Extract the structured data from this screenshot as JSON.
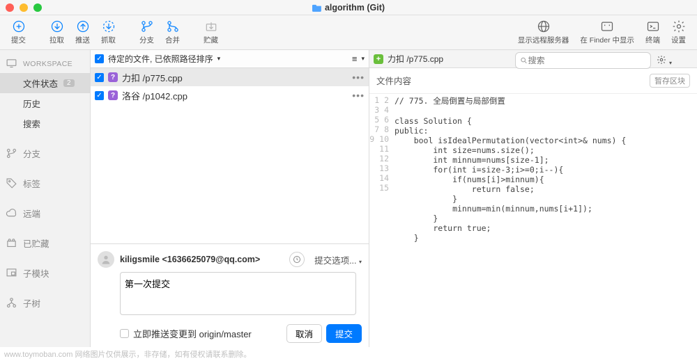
{
  "window": {
    "title": "algorithm (Git)"
  },
  "toolbar": {
    "commit": "提交",
    "pull": "拉取",
    "push": "推送",
    "fetch": "抓取",
    "branch": "分支",
    "merge": "合并",
    "stash": "贮藏",
    "remote_server": "显示远程服务器",
    "finder": "在 Finder 中显示",
    "terminal": "终端",
    "settings": "设置",
    "search_placeholder": "搜索"
  },
  "sidebar": {
    "workspace_header": "WORKSPACE",
    "file_status": "文件状态",
    "file_status_badge": "2",
    "history": "历史",
    "search": "搜索",
    "branches": "分支",
    "tags": "标签",
    "remotes": "远端",
    "stashes": "已贮藏",
    "submodules": "子模块",
    "subtrees": "子树"
  },
  "sorter": "待定的文件, 已依照路径排序",
  "files": [
    {
      "label": "力扣 /p775.cpp",
      "active": true
    },
    {
      "label": "洛谷 /p1042.cpp",
      "active": false
    }
  ],
  "right": {
    "tab": "力扣 /p775.cpp",
    "file_content_label": "文件内容",
    "hunk_label": "暂存区块",
    "lines": [
      "// 775. 全局倒置与局部倒置",
      "",
      "class Solution {",
      "public:",
      "    bool isIdealPermutation(vector<int>& nums) {",
      "        int size=nums.size();",
      "        int minnum=nums[size-1];",
      "        for(int i=size-3;i>=0;i--){",
      "            if(nums[i]>minnum){",
      "                return false;",
      "            }",
      "            minnum=min(minnum,nums[i+1]);",
      "        }",
      "        return true;",
      "    }"
    ]
  },
  "commit": {
    "author": "kiligsmile <1636625079@qq.com>",
    "message": "第一次提交",
    "push_label": "立即推送变更到 origin/master",
    "cancel": "取消",
    "submit": "提交",
    "options": "提交选项..."
  },
  "watermark": "www.toymoban.com 网络图片仅供展示，非存储，如有侵权请联系删除。"
}
